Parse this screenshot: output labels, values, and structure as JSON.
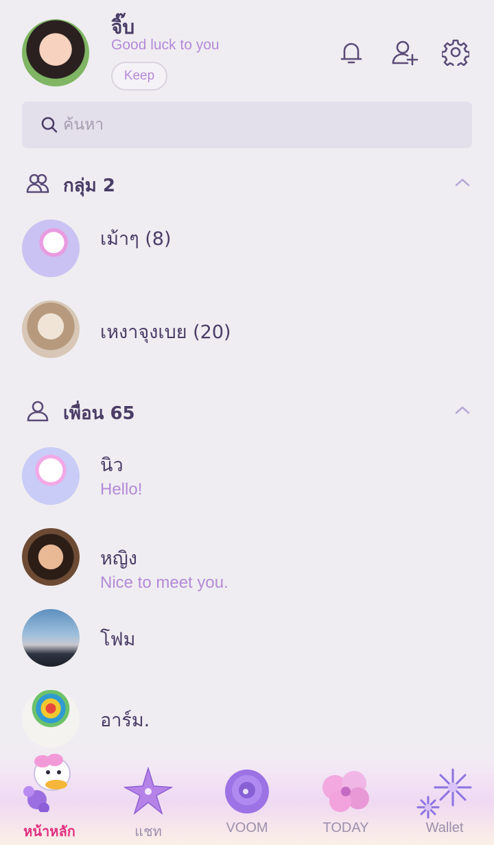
{
  "profile": {
    "name": "จิ๊บ",
    "status": "Good luck to you",
    "keep_label": "Keep"
  },
  "top_icons": [
    "bell-icon",
    "add-friend-icon",
    "gear-icon"
  ],
  "search": {
    "placeholder": "ค้นหา"
  },
  "groups": {
    "title": "กลุ่ม 2",
    "items": [
      {
        "name": "เม้าๆ (8)"
      },
      {
        "name": "เหงาจุงเบย (20)"
      }
    ]
  },
  "friends": {
    "title": "เพื่อน 65",
    "items": [
      {
        "name": "นิว",
        "message": "Hello!"
      },
      {
        "name": "หญิง",
        "message": "Nice to meet you."
      },
      {
        "name": "โฟม",
        "message": ""
      },
      {
        "name": "อาร์ม.",
        "message": ""
      }
    ]
  },
  "tabs": [
    {
      "label": "หน้าหลัก",
      "icon": "home-daisy-icon",
      "active": true
    },
    {
      "label": "แชท",
      "icon": "chat-star-flower-icon",
      "active": false
    },
    {
      "label": "VOOM",
      "icon": "voom-rose-icon",
      "active": false
    },
    {
      "label": "TODAY",
      "icon": "today-flower-icon",
      "active": false
    },
    {
      "label": "Wallet",
      "icon": "wallet-daisy-icon",
      "active": false
    }
  ],
  "colors": {
    "background": "#efedf1",
    "accent_purple": "#b48ad8",
    "text_dark": "#4a3c66",
    "active_tab": "#e0317f"
  }
}
